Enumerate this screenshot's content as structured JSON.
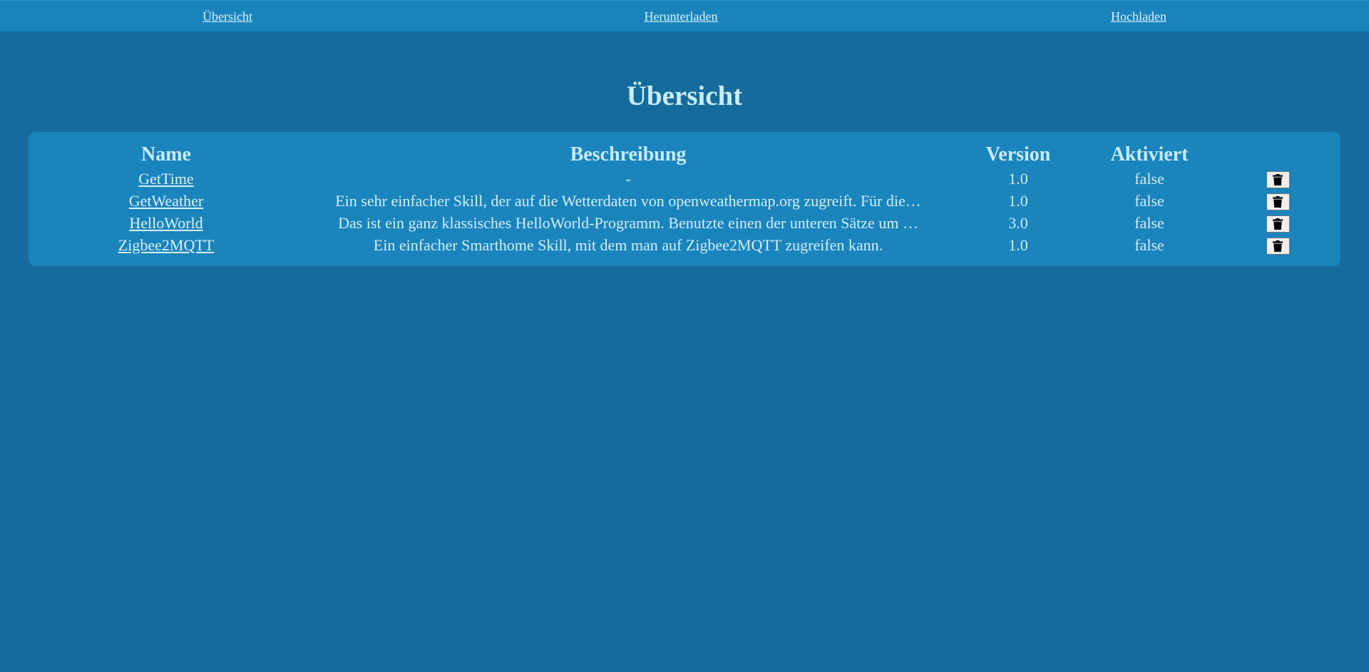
{
  "nav": {
    "items": [
      {
        "label": "Übersicht"
      },
      {
        "label": "Herunterladen"
      },
      {
        "label": "Hochladen"
      }
    ]
  },
  "page": {
    "title": "Übersicht"
  },
  "table": {
    "headers": {
      "name": "Name",
      "description": "Beschreibung",
      "version": "Version",
      "enabled": "Aktiviert",
      "actions": ""
    },
    "rows": [
      {
        "name": "GetTime",
        "description": "-",
        "version": "1.0",
        "enabled": "false",
        "action_icon": "trash-icon"
      },
      {
        "name": "GetWeather",
        "description": "Ein sehr einfacher Skill, der auf die Wetterdaten von openweathermap.org zugreift. Für die…",
        "version": "1.0",
        "enabled": "false",
        "action_icon": "trash-icon"
      },
      {
        "name": "HelloWorld",
        "description": "Das ist ein ganz klassisches HelloWorld-Programm. Benutzte einen der unteren Sätze um …",
        "version": "3.0",
        "enabled": "false",
        "action_icon": "trash-icon"
      },
      {
        "name": "Zigbee2MQTT",
        "description": "Ein einfacher Smarthome Skill, mit dem man auf Zigbee2MQTT zugreifen kann.",
        "version": "1.0",
        "enabled": "false",
        "action_icon": "trash-icon"
      }
    ]
  },
  "colors": {
    "background": "#156b9b",
    "nav_background": "#1984bc",
    "panel_background": "#1a84bc",
    "text": "#c8ecfa"
  }
}
